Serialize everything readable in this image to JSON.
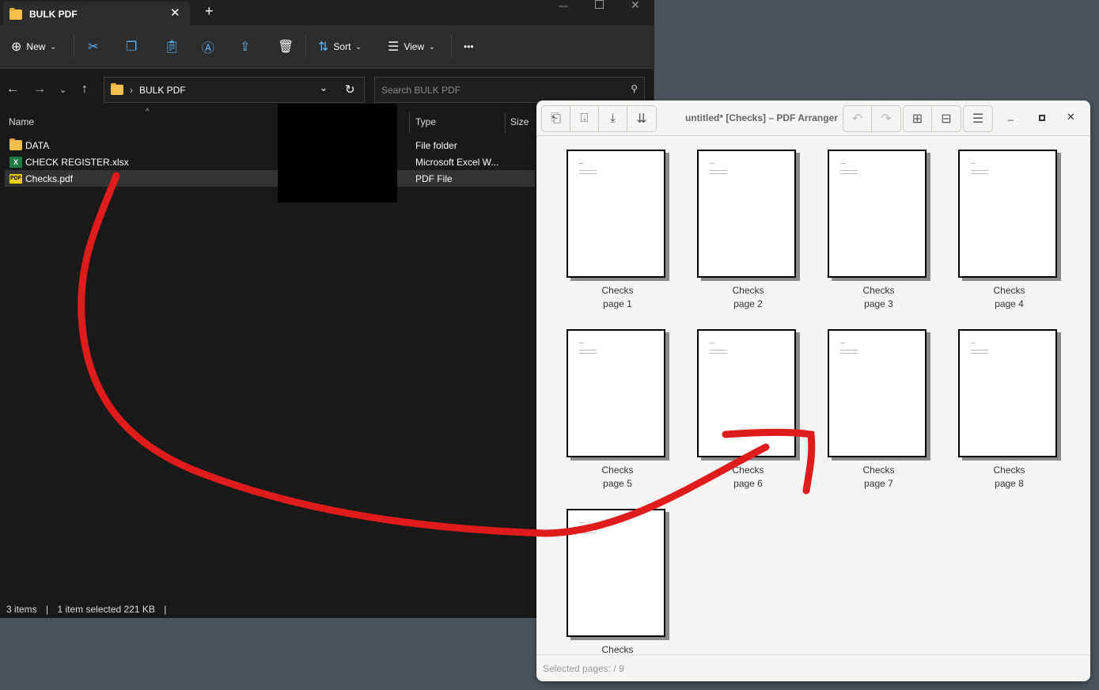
{
  "explorer": {
    "tab_title": "BULK PDF",
    "toolbar": {
      "new": "New",
      "sort": "Sort",
      "view": "View",
      "more": "•••"
    },
    "breadcrumb": "BULK PDF",
    "search_placeholder": "Search BULK PDF",
    "columns": {
      "name": "Name",
      "type": "Type",
      "size": "Size"
    },
    "files": [
      {
        "name": "DATA",
        "type": "File folder",
        "icon": "folder-icon"
      },
      {
        "name": "CHECK REGISTER.xlsx",
        "type": "Microsoft Excel W...",
        "icon": "excel-icon"
      },
      {
        "name": "Checks.pdf",
        "type": "PDF File",
        "icon": "pdf-icon",
        "selected": true
      }
    ],
    "status": {
      "count": "3 items",
      "selection": "1 item selected  221 KB"
    }
  },
  "arranger": {
    "title": "untitled* [Checks] – PDF Arranger",
    "pages": [
      {
        "doc": "Checks",
        "page": "page 1"
      },
      {
        "doc": "Checks",
        "page": "page 2"
      },
      {
        "doc": "Checks",
        "page": "page 3"
      },
      {
        "doc": "Checks",
        "page": "page 4"
      },
      {
        "doc": "Checks",
        "page": "page 5"
      },
      {
        "doc": "Checks",
        "page": "page 6"
      },
      {
        "doc": "Checks",
        "page": "page 7"
      },
      {
        "doc": "Checks",
        "page": "page 8"
      },
      {
        "doc": "Checks",
        "page": ""
      }
    ],
    "status": "Selected pages:  / 9"
  },
  "colors": {
    "annotation": "#e01b1b",
    "explorer_bg": "#191919",
    "arranger_bg": "#f6f5f4"
  }
}
